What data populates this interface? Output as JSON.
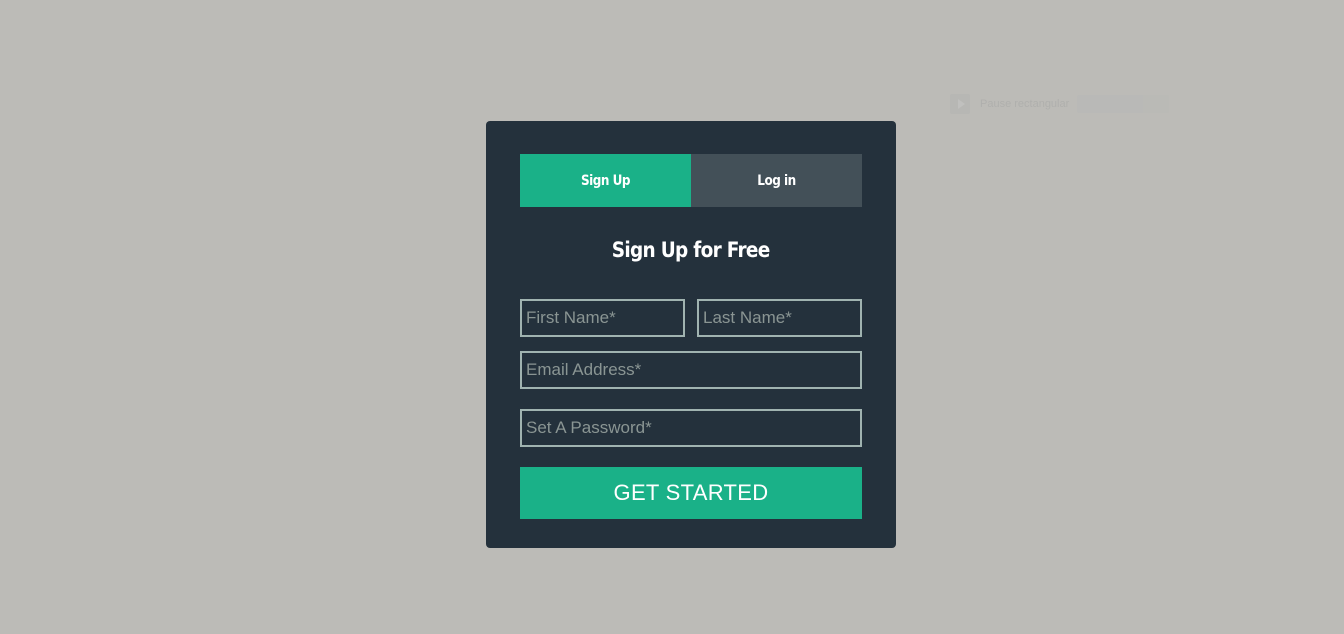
{
  "overlay": {
    "label": "Pause rectangular",
    "icon": "play-icon"
  },
  "form": {
    "tabs": [
      {
        "label": "Sign Up",
        "active": true
      },
      {
        "label": "Log in",
        "active": false
      }
    ],
    "title": "Sign Up for Free",
    "fields": {
      "first_name": {
        "placeholder": "First Name*",
        "value": ""
      },
      "last_name": {
        "placeholder": "Last Name*",
        "value": ""
      },
      "email": {
        "placeholder": "Email Address*",
        "value": ""
      },
      "password": {
        "placeholder": "Set A Password*",
        "value": ""
      }
    },
    "submit_label": "GET STARTED"
  },
  "colors": {
    "background": "#bcbbb7",
    "card": "#24313c",
    "accent": "#1ab188",
    "inactive_tab": "#435058",
    "field_border": "#a0b3b0"
  }
}
